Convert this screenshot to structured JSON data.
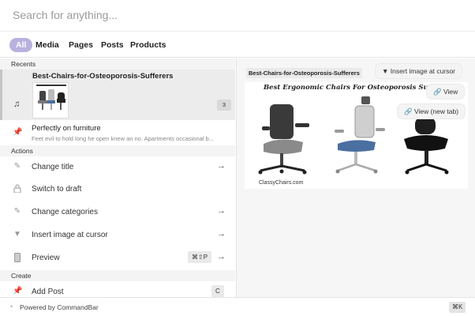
{
  "search": {
    "placeholder": "Search for anything..."
  },
  "tabs": [
    {
      "label": "All"
    },
    {
      "label": "Media"
    },
    {
      "label": "Pages"
    },
    {
      "label": "Posts"
    },
    {
      "label": "Products"
    }
  ],
  "sections": {
    "recents": "Recents",
    "actions": "Actions",
    "create": "Create"
  },
  "recents": [
    {
      "title": "Best-Chairs-for-Osteoporosis-Sufferers",
      "badge": "3"
    },
    {
      "title": "Perfectly on furniture",
      "subtitle": "Feet evil to hold long he open knew an no. Apartments occasional b..."
    }
  ],
  "actions": [
    {
      "label": "Change title",
      "icon": "pencil-icon"
    },
    {
      "label": "Switch to draft",
      "icon": "lock-icon"
    },
    {
      "label": "Change categories",
      "icon": "pencil-icon"
    },
    {
      "label": "Insert image at cursor",
      "icon": "triangle-down-icon"
    },
    {
      "label": "Preview",
      "icon": "phone-icon",
      "shortcut": "⌘⇧P"
    }
  ],
  "create": [
    {
      "label": "Add Post",
      "icon": "pin-icon",
      "shortcut": "C"
    }
  ],
  "preview": {
    "title_chip": "Best-Chairs-for-Osteoporosis-Sufferers",
    "image_heading": "Best Ergonomic Chairs For Osteoporosis Suff",
    "image_caption": "ClassyChairs.com",
    "insert_button": "Insert image at cursor",
    "view_button": "View",
    "view_new_tab_button": "View (new tab)"
  },
  "footer": {
    "text": "Powered by CommandBar",
    "shortcut": "⌘K"
  },
  "colors": {
    "accent": "#b9b1de",
    "panel": "#f6f6f6"
  }
}
